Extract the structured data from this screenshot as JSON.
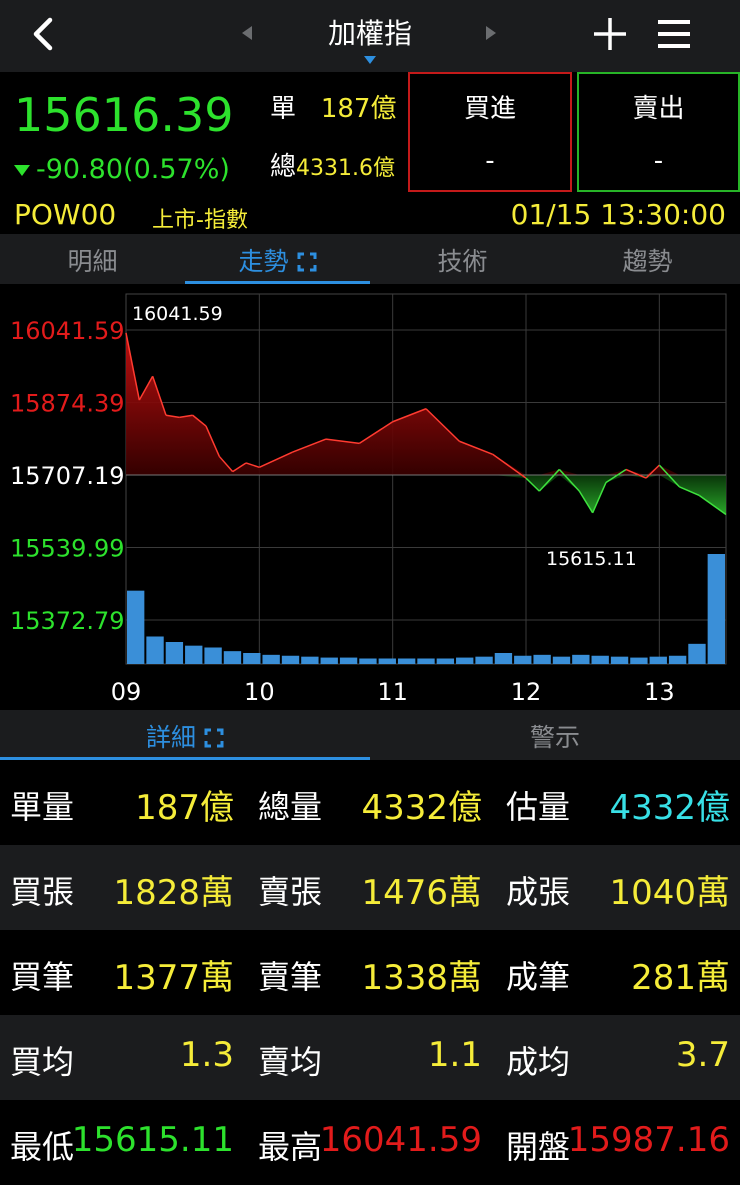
{
  "header": {
    "title": "加權指"
  },
  "quote": {
    "price": "15616.39",
    "change": "-90.80",
    "change_pct": "(0.57%)",
    "unit_vol_label": "單",
    "unit_vol": "187",
    "unit_vol_unit": "億",
    "total_vol_label": "總",
    "total_vol": "4331.6",
    "total_vol_unit": "億",
    "buy_label": "買進",
    "buy_value": "-",
    "sell_label": "賣出",
    "sell_value": "-",
    "code": "POW00",
    "market": "上市-指數",
    "datetime": "01/15 13:30:00"
  },
  "tabs": [
    "明細",
    "走勢",
    "技術",
    "趨勢"
  ],
  "subtabs": [
    "詳細",
    "警示"
  ],
  "colors": {
    "up": "#e21b1b",
    "down": "#2de22d",
    "accent": "#2d8fe0",
    "highlight": "#f5ec39",
    "cyan": "#38e0e6"
  },
  "chart_data": {
    "type": "line",
    "y_ticks": [
      "16041.59",
      "15874.39",
      "15707.19",
      "15539.99",
      "15372.79"
    ],
    "x_ticks": [
      "09",
      "10",
      "11",
      "12",
      "13"
    ],
    "reference": 15707.19,
    "high_label": "16041.59",
    "low_label": "15615.11",
    "ylim": [
      15372.79,
      16041.59
    ],
    "series": [
      {
        "x": [
          9.0,
          9.1,
          9.2,
          9.3,
          9.4,
          9.5,
          9.6,
          9.7,
          9.8,
          9.9,
          10.0,
          10.25,
          10.5,
          10.75,
          11.0,
          11.25,
          11.5,
          11.75,
          12.0,
          12.1,
          12.25,
          12.4,
          12.5,
          12.6,
          12.75,
          12.9,
          13.0,
          13.15,
          13.3,
          13.5
        ],
        "values": [
          16035,
          15880,
          15935,
          15845,
          15840,
          15845,
          15820,
          15750,
          15715,
          15735,
          15725,
          15760,
          15790,
          15780,
          15830,
          15860,
          15785,
          15755,
          15700,
          15670,
          15720,
          15670,
          15620,
          15690,
          15720,
          15700,
          15730,
          15680,
          15660,
          15616
        ]
      }
    ],
    "volume": [
      80,
      30,
      24,
      20,
      18,
      14,
      12,
      10,
      9,
      8,
      7,
      7,
      6,
      6,
      6,
      6,
      6,
      7,
      8,
      12,
      9,
      10,
      8,
      10,
      9,
      8,
      7,
      8,
      9,
      22,
      120
    ]
  },
  "stats": [
    [
      {
        "key": "單量",
        "value": "187億",
        "color": "highlight"
      },
      {
        "key": "總量",
        "value": "4332億",
        "color": "highlight"
      },
      {
        "key": "估量",
        "value": "4332億",
        "color": "cyan"
      }
    ],
    [
      {
        "key": "買張",
        "value": "1828萬",
        "color": "highlight"
      },
      {
        "key": "賣張",
        "value": "1476萬",
        "color": "highlight"
      },
      {
        "key": "成張",
        "value": "1040萬",
        "color": "highlight"
      }
    ],
    [
      {
        "key": "買筆",
        "value": "1377萬",
        "color": "highlight"
      },
      {
        "key": "賣筆",
        "value": "1338萬",
        "color": "highlight"
      },
      {
        "key": "成筆",
        "value": "281萬",
        "color": "highlight"
      }
    ],
    [
      {
        "key": "買均",
        "value": "1.3",
        "color": "highlight"
      },
      {
        "key": "賣均",
        "value": "1.1",
        "color": "highlight"
      },
      {
        "key": "成均",
        "value": "3.7",
        "color": "highlight"
      }
    ],
    [
      {
        "key": "最低",
        "value": "15615.11",
        "color": "down"
      },
      {
        "key": "最高",
        "value": "16041.59",
        "color": "up"
      },
      {
        "key": "開盤",
        "value": "15987.16",
        "color": "up"
      }
    ]
  ]
}
